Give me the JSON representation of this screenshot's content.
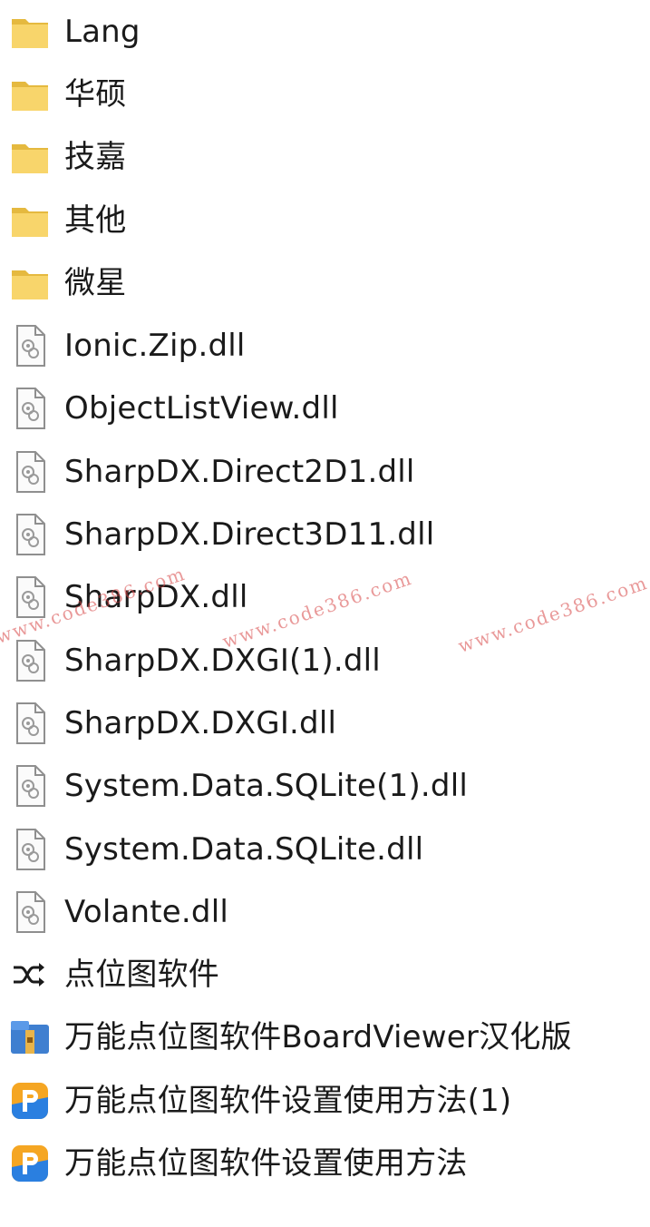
{
  "files": [
    {
      "name": "Lang",
      "icon": "folder-icon"
    },
    {
      "name": "华硕",
      "icon": "folder-icon"
    },
    {
      "name": "技嘉",
      "icon": "folder-icon"
    },
    {
      "name": "其他",
      "icon": "folder-icon"
    },
    {
      "name": "微星",
      "icon": "folder-icon"
    },
    {
      "name": "Ionic.Zip.dll",
      "icon": "dll-file-icon"
    },
    {
      "name": "ObjectListView.dll",
      "icon": "dll-file-icon"
    },
    {
      "name": "SharpDX.Direct2D1.dll",
      "icon": "dll-file-icon"
    },
    {
      "name": "SharpDX.Direct3D11.dll",
      "icon": "dll-file-icon"
    },
    {
      "name": "SharpDX.dll",
      "icon": "dll-file-icon"
    },
    {
      "name": "SharpDX.DXGI(1).dll",
      "icon": "dll-file-icon"
    },
    {
      "name": "SharpDX.DXGI.dll",
      "icon": "dll-file-icon"
    },
    {
      "name": "System.Data.SQLite(1).dll",
      "icon": "dll-file-icon"
    },
    {
      "name": "System.Data.SQLite.dll",
      "icon": "dll-file-icon"
    },
    {
      "name": "Volante.dll",
      "icon": "dll-file-icon"
    },
    {
      "name": "点位图软件",
      "icon": "shuffle-icon"
    },
    {
      "name": "万能点位图软件BoardViewer汉化版",
      "icon": "installer-package-icon"
    },
    {
      "name": "万能点位图软件设置使用方法(1)",
      "icon": "document-app-icon"
    },
    {
      "name": "万能点位图软件设置使用方法",
      "icon": "document-app-icon"
    }
  ],
  "watermark": {
    "text": "www.code386.com"
  },
  "colors": {
    "folder": "#f8d56b",
    "folder_shade": "#e5b93f",
    "doc_app_orange": "#f5a623",
    "doc_app_blue": "#2a7fe0",
    "watermark": "#d74646"
  }
}
